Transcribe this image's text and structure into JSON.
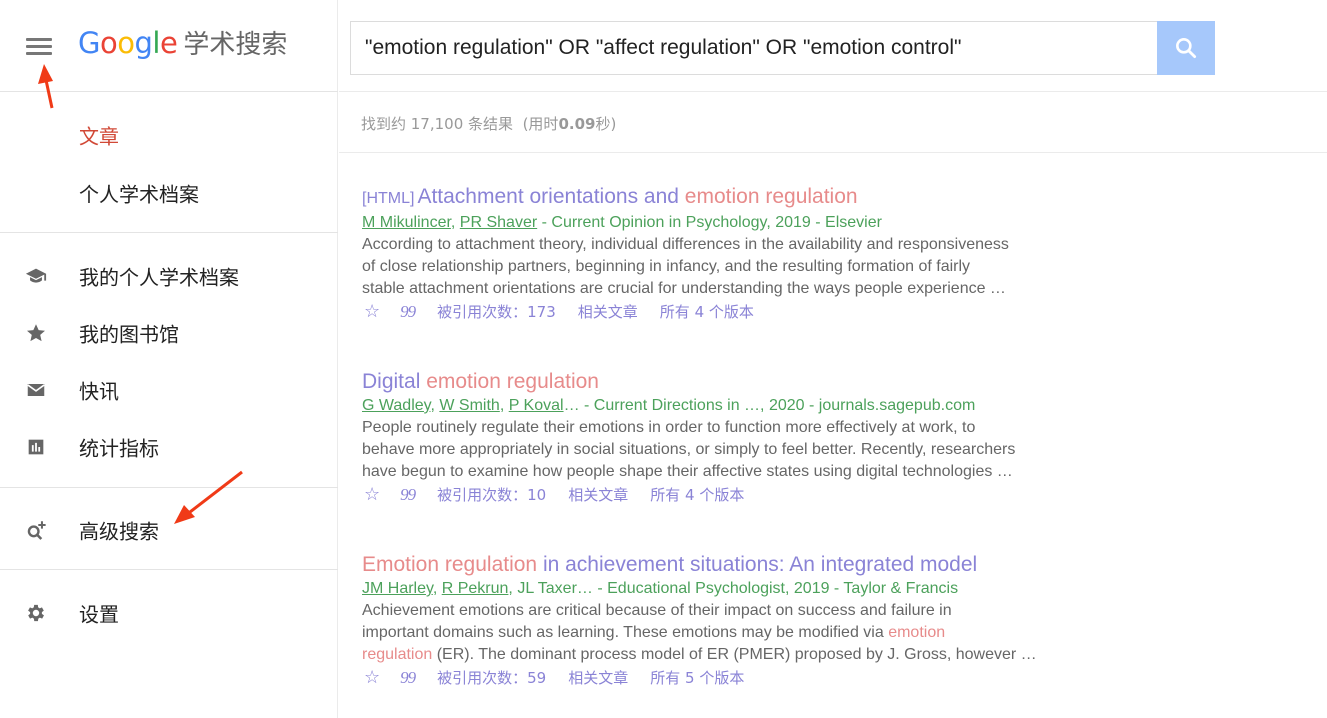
{
  "header": {
    "logo_text": "Google",
    "logo_suffix": "学术搜索",
    "logo_colors": [
      "#4285f4",
      "#ea4335",
      "#fbbc05",
      "#4285f4",
      "#34a853",
      "#ea4335"
    ]
  },
  "sidebar": {
    "items": [
      {
        "label": "文章",
        "active": true
      },
      {
        "label": "个人学术档案"
      },
      {
        "label": "我的个人学术档案",
        "icon": "graduation-cap-icon"
      },
      {
        "label": "我的图书馆",
        "icon": "star-icon"
      },
      {
        "label": "快讯",
        "icon": "envelope-icon"
      },
      {
        "label": "统计指标",
        "icon": "bar-chart-icon"
      },
      {
        "label": "高级搜索",
        "icon": "advanced-search-icon"
      },
      {
        "label": "设置",
        "icon": "gear-icon"
      }
    ]
  },
  "search": {
    "query": "\"emotion regulation\" OR \"affect regulation\" OR \"emotion control\"",
    "button_color": "#a6c8fb"
  },
  "stats": {
    "prefix": "找到约 17,100 条结果",
    "timing_open": "(用时",
    "timing_value": "0.09",
    "timing_close": "秒)"
  },
  "results": [
    {
      "tag": "[HTML]",
      "title_parts": [
        "Attachment orientations and ",
        "emotion regulation"
      ],
      "authors": [
        "M Mikulincer",
        "PR Shaver"
      ],
      "source": " - Current Opinion in Psychology, 2019 - Elsevier",
      "snippet_lines": [
        "According to attachment theory, individual differences in the availability and responsiveness",
        "of close relationship partners, beginning in infancy, and the resulting formation of fairly",
        "stable attachment orientations are crucial for understanding the ways people experience …"
      ],
      "cited": "被引用次数：173",
      "related": "相关文章",
      "versions": "所有 4 个版本"
    },
    {
      "title_parts": [
        "Digital ",
        "emotion regulation"
      ],
      "authors": [
        "G Wadley",
        "W Smith",
        "P Koval"
      ],
      "source": "… - Current Directions in …, 2020 - journals.sagepub.com",
      "snippet_lines": [
        "People routinely regulate their emotions in order to function more effectively at work, to",
        "behave more appropriately in social situations, or simply to feel better. Recently, researchers",
        "have begun to examine how people shape their affective states using digital technologies …"
      ],
      "cited": "被引用次数：10",
      "related": "相关文章",
      "versions": "所有 4 个版本"
    },
    {
      "title_parts": [
        "Emotion regulation",
        " in achievement situations: An integrated model"
      ],
      "authors": [
        "JM Harley",
        "R Pekrun"
      ],
      "authors_rest": ", JL Taxer… - Educational Psychologist, 2019 - Taylor & Francis",
      "snippet_lines": [
        "Achievement emotions are critical because of their impact on success and failure in",
        "important domains such as learning. These emotions may be modified via ",
        "emotion",
        "regulation",
        " (ER). The dominant process model of ER (PMER) proposed by J. Gross, however …"
      ],
      "cited": "被引用次数：59",
      "related": "相关文章",
      "versions": "所有 5 个版本"
    }
  ]
}
